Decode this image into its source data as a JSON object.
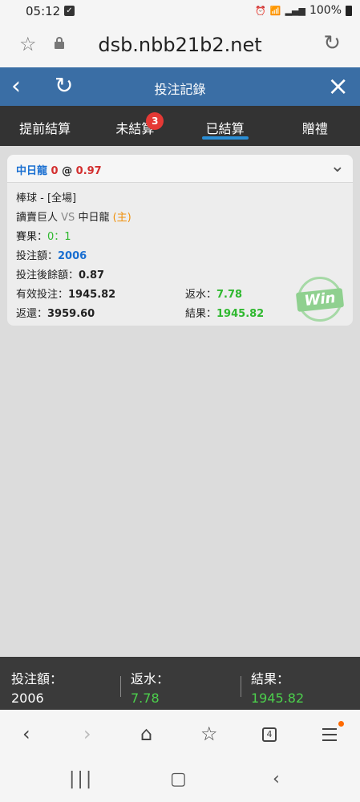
{
  "status_bar": {
    "time": "05:12",
    "battery": "100%"
  },
  "address_bar": {
    "url": "dsb.nbb21b2.net"
  },
  "header": {
    "title": "投注記錄"
  },
  "tabs": [
    {
      "label": "提前結算"
    },
    {
      "label": "未結算",
      "badge": "3"
    },
    {
      "label": "已結算",
      "active": true
    },
    {
      "label": "贈禮"
    }
  ],
  "bet": {
    "team": "中日龍",
    "handicap": "0",
    "at": "@",
    "odds": "0.97",
    "league": "棒球 - [全場]",
    "away_team": "讀賣巨人",
    "vs": "VS",
    "home_team": "中日龍",
    "home_tag": "(主)",
    "score_label": "賽果：",
    "score": "0：1",
    "stake_label": "投注額：",
    "stake": "2006",
    "balance_label": "投注後餘額：",
    "balance": "0.87",
    "valid_label": "有效投注：",
    "valid": "1945.82",
    "rebate_label": "返水：",
    "rebate": "7.78",
    "return_label": "返還：",
    "return": "3959.60",
    "result_label": "結果：",
    "result": "1945.82",
    "stamp": "Win"
  },
  "summary": {
    "stake_label": "投注額：",
    "stake": "2006",
    "rebate_label": "返水：",
    "rebate": "7.78",
    "result_label": "結果：",
    "result": "1945.82"
  },
  "browser_nav": {
    "tab_count": "4"
  },
  "colors": {
    "header": "#3a6ea5",
    "tabbar": "#333333",
    "accent_underline": "#2b8fd6",
    "positive": "#2fb82f",
    "badge": "#e53935"
  }
}
